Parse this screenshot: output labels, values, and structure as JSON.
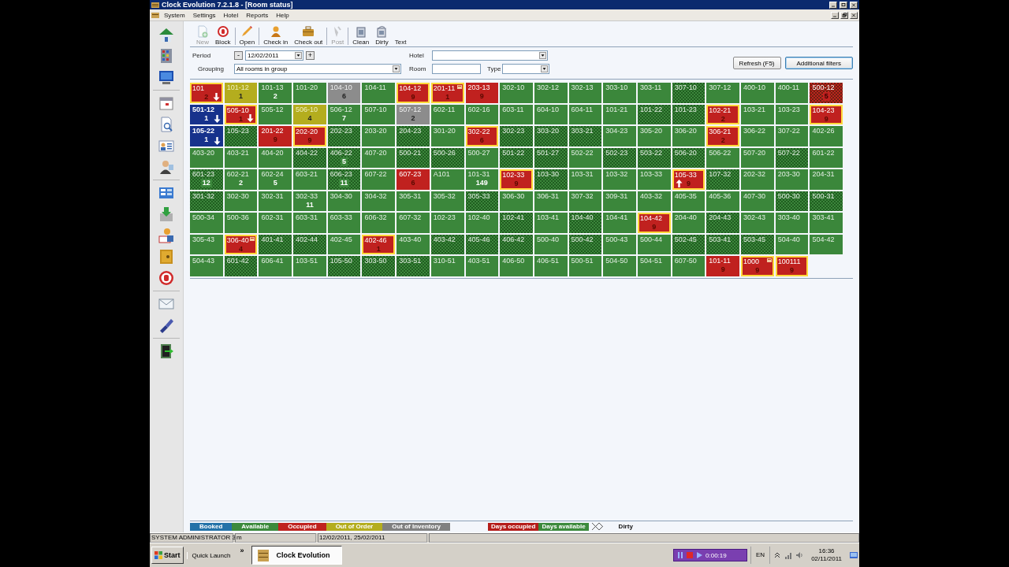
{
  "window": {
    "title": "Clock Evolution 7.2.1.8 - [Room status]"
  },
  "menu": [
    "System",
    "Settings",
    "Hotel",
    "Reports",
    "Help"
  ],
  "toolbar": [
    {
      "kind": "new",
      "label": "New",
      "disabled": true,
      "separator": false
    },
    {
      "kind": "block",
      "label": "Block",
      "disabled": false,
      "separator": true
    },
    {
      "kind": "open",
      "label": "Open",
      "disabled": false,
      "separator": true
    },
    {
      "kind": "checkin",
      "label": "Check in",
      "disabled": false,
      "separator": false
    },
    {
      "kind": "checkout",
      "label": "Check out",
      "disabled": false,
      "separator": true
    },
    {
      "kind": "post",
      "label": "Post",
      "disabled": true,
      "separator": true
    },
    {
      "kind": "clean",
      "label": "Clean",
      "disabled": false,
      "separator": false
    },
    {
      "kind": "dirty",
      "label": "Dirty",
      "disabled": false,
      "separator": false
    },
    {
      "kind": "text",
      "label": "Text",
      "disabled": false,
      "separator": false
    }
  ],
  "filters": {
    "period": {
      "label": "Period",
      "decrement": "-",
      "date": "12/02/2011",
      "increment": "+"
    },
    "grouping": {
      "label": "Grouping",
      "value": "All rooms in group"
    },
    "hotel": {
      "label": "Hotel"
    },
    "room": {
      "label": "Room"
    },
    "type": {
      "label": "Type"
    }
  },
  "buttons": [
    {
      "label": "Refresh (F5)",
      "focused": false
    },
    {
      "label": "Additional filters",
      "focused": true
    }
  ],
  "rooms": [
    {
      "label": "101",
      "count": "2",
      "kind": "occupied",
      "dirty": false,
      "highlighted": true,
      "arrow_down": true,
      "arrow_up": false,
      "note": false
    },
    {
      "label": "101-12",
      "count": "1",
      "kind": "out_of_order",
      "dirty": false,
      "highlighted": false,
      "arrow_down": false,
      "arrow_up": false,
      "note": false
    },
    {
      "label": "101-13",
      "count": "2",
      "kind": "available",
      "dirty": false,
      "highlighted": false,
      "arrow_down": false,
      "arrow_up": false,
      "note": false
    },
    {
      "label": "101-20",
      "kind": "available",
      "dirty": false,
      "highlighted": false,
      "arrow_down": false,
      "arrow_up": false,
      "note": false
    },
    {
      "label": "104-10",
      "count": "6",
      "kind": "out_of_inventory",
      "dirty": false,
      "highlighted": false,
      "arrow_down": false,
      "arrow_up": false,
      "note": false
    },
    {
      "label": "104-11",
      "kind": "available",
      "dirty": false,
      "highlighted": false,
      "arrow_down": false,
      "arrow_up": false,
      "note": false
    },
    {
      "label": "104-12",
      "count": "9",
      "kind": "occupied",
      "dirty": false,
      "highlighted": true,
      "arrow_down": false,
      "arrow_up": false,
      "note": false
    },
    {
      "label": "201-11",
      "count": "1",
      "kind": "occupied",
      "dirty": false,
      "highlighted": true,
      "arrow_down": false,
      "arrow_up": false,
      "note": true
    },
    {
      "label": "203-13",
      "count": "9",
      "kind": "occupied",
      "dirty": false,
      "highlighted": false,
      "arrow_down": false,
      "arrow_up": false,
      "note": false
    },
    {
      "label": "302-10",
      "kind": "available",
      "dirty": false,
      "highlighted": false,
      "arrow_down": false,
      "arrow_up": false,
      "note": false
    },
    {
      "label": "302-12",
      "kind": "available",
      "dirty": false,
      "highlighted": false,
      "arrow_down": false,
      "arrow_up": false,
      "note": false
    },
    {
      "label": "302-13",
      "kind": "available",
      "dirty": false,
      "highlighted": false,
      "arrow_down": false,
      "arrow_up": false,
      "note": false
    },
    {
      "label": "303-10",
      "kind": "available",
      "dirty": false,
      "highlighted": false,
      "arrow_down": false,
      "arrow_up": false,
      "note": false
    },
    {
      "label": "303-11",
      "kind": "available",
      "dirty": false,
      "highlighted": false,
      "arrow_down": false,
      "arrow_up": false,
      "note": false
    },
    {
      "label": "307-10",
      "kind": "available",
      "dirty": true,
      "highlighted": false,
      "arrow_down": false,
      "arrow_up": false,
      "note": false
    },
    {
      "label": "307-12",
      "kind": "available",
      "dirty": false,
      "highlighted": false,
      "arrow_down": false,
      "arrow_up": false,
      "note": false
    },
    {
      "label": "400-10",
      "kind": "available",
      "dirty": false,
      "highlighted": false,
      "arrow_down": false,
      "arrow_up": false,
      "note": false
    },
    {
      "label": "400-11",
      "kind": "available",
      "dirty": false,
      "highlighted": false,
      "arrow_down": false,
      "arrow_up": false,
      "note": false
    },
    {
      "label": "500-12",
      "count": "5",
      "kind": "occupied",
      "dirty": true,
      "highlighted": false,
      "arrow_down": false,
      "arrow_up": false,
      "note": false
    },
    {
      "label": "501-12",
      "count": "1",
      "kind": "booked",
      "dirty": false,
      "highlighted": false,
      "arrow_down": true,
      "arrow_up": false,
      "note": false
    },
    {
      "label": "505-10",
      "count": "1",
      "kind": "occupied",
      "dirty": false,
      "highlighted": true,
      "arrow_down": true,
      "arrow_up": false,
      "note": false
    },
    {
      "label": "505-12",
      "kind": "available",
      "dirty": false,
      "highlighted": false,
      "arrow_down": false,
      "arrow_up": false,
      "note": false
    },
    {
      "label": "506-10",
      "count": "4",
      "kind": "out_of_order",
      "dirty": false,
      "highlighted": false,
      "arrow_down": false,
      "arrow_up": false,
      "note": false
    },
    {
      "label": "506-12",
      "count": "7",
      "kind": "available",
      "dirty": false,
      "highlighted": false,
      "arrow_down": false,
      "arrow_up": false,
      "note": false
    },
    {
      "label": "507-10",
      "kind": "available",
      "dirty": false,
      "highlighted": false,
      "arrow_down": false,
      "arrow_up": false,
      "note": false
    },
    {
      "label": "507-12",
      "count": "2",
      "kind": "out_of_inventory",
      "dirty": false,
      "highlighted": false,
      "arrow_down": false,
      "arrow_up": false,
      "note": false
    },
    {
      "label": "602-11",
      "kind": "available",
      "dirty": false,
      "highlighted": false,
      "arrow_down": false,
      "arrow_up": false,
      "note": false
    },
    {
      "label": "602-16",
      "kind": "available",
      "dirty": false,
      "highlighted": false,
      "arrow_down": false,
      "arrow_up": false,
      "note": false
    },
    {
      "label": "603-11",
      "kind": "available",
      "dirty": false,
      "highlighted": false,
      "arrow_down": false,
      "arrow_up": false,
      "note": false
    },
    {
      "label": "604-10",
      "kind": "available",
      "dirty": false,
      "highlighted": false,
      "arrow_down": false,
      "arrow_up": false,
      "note": false
    },
    {
      "label": "604-11",
      "kind": "available",
      "dirty": false,
      "highlighted": false,
      "arrow_down": false,
      "arrow_up": false,
      "note": false
    },
    {
      "label": "101-21",
      "kind": "available",
      "dirty": false,
      "highlighted": false,
      "arrow_down": false,
      "arrow_up": false,
      "note": false
    },
    {
      "label": "101-22",
      "kind": "available",
      "dirty": true,
      "highlighted": false,
      "arrow_down": false,
      "arrow_up": false,
      "note": false
    },
    {
      "label": "101-23",
      "kind": "available",
      "dirty": true,
      "highlighted": false,
      "arrow_down": false,
      "arrow_up": false,
      "note": false
    },
    {
      "label": "102-21",
      "count": "2",
      "kind": "occupied",
      "dirty": false,
      "highlighted": true,
      "arrow_down": false,
      "arrow_up": false,
      "note": false
    },
    {
      "label": "103-21",
      "kind": "available",
      "dirty": false,
      "highlighted": false,
      "arrow_down": false,
      "arrow_up": false,
      "note": false
    },
    {
      "label": "103-23",
      "kind": "available",
      "dirty": false,
      "highlighted": false,
      "arrow_down": false,
      "arrow_up": false,
      "note": false
    },
    {
      "label": "104-23",
      "count": "9",
      "kind": "occupied",
      "dirty": false,
      "highlighted": true,
      "arrow_down": false,
      "arrow_up": false,
      "note": false
    },
    {
      "label": "105-22",
      "count": "1",
      "kind": "booked",
      "dirty": false,
      "highlighted": false,
      "arrow_down": true,
      "arrow_up": false,
      "note": false
    },
    {
      "label": "105-23",
      "kind": "available",
      "dirty": true,
      "highlighted": false,
      "arrow_down": false,
      "arrow_up": false,
      "note": false
    },
    {
      "label": "201-22",
      "count": "9",
      "kind": "occupied",
      "dirty": false,
      "highlighted": false,
      "arrow_down": false,
      "arrow_up": false,
      "note": false
    },
    {
      "label": "202-20",
      "count": "9",
      "kind": "occupied",
      "dirty": false,
      "highlighted": true,
      "arrow_down": false,
      "arrow_up": false,
      "note": false
    },
    {
      "label": "202-23",
      "kind": "available",
      "dirty": true,
      "highlighted": false,
      "arrow_down": false,
      "arrow_up": false,
      "note": false
    },
    {
      "label": "203-20",
      "kind": "available",
      "dirty": false,
      "highlighted": false,
      "arrow_down": false,
      "arrow_up": false,
      "note": false
    },
    {
      "label": "204-23",
      "kind": "available",
      "dirty": true,
      "highlighted": false,
      "arrow_down": false,
      "arrow_up": false,
      "note": false
    },
    {
      "label": "301-20",
      "kind": "available",
      "dirty": false,
      "highlighted": false,
      "arrow_down": false,
      "arrow_up": false,
      "note": false
    },
    {
      "label": "302-22",
      "count": "6",
      "kind": "occupied",
      "dirty": false,
      "highlighted": true,
      "arrow_down": false,
      "arrow_up": false,
      "note": false
    },
    {
      "label": "302-23",
      "kind": "available",
      "dirty": true,
      "highlighted": false,
      "arrow_down": false,
      "arrow_up": false,
      "note": false
    },
    {
      "label": "303-20",
      "kind": "available",
      "dirty": true,
      "highlighted": false,
      "arrow_down": false,
      "arrow_up": false,
      "note": false
    },
    {
      "label": "303-21",
      "kind": "available",
      "dirty": true,
      "highlighted": false,
      "arrow_down": false,
      "arrow_up": false,
      "note": false
    },
    {
      "label": "304-23",
      "kind": "available",
      "dirty": false,
      "highlighted": false,
      "arrow_down": false,
      "arrow_up": false,
      "note": false
    },
    {
      "label": "305-20",
      "kind": "available",
      "dirty": false,
      "highlighted": false,
      "arrow_down": false,
      "arrow_up": false,
      "note": false
    },
    {
      "label": "306-20",
      "kind": "available",
      "dirty": false,
      "highlighted": false,
      "arrow_down": false,
      "arrow_up": false,
      "note": false
    },
    {
      "label": "306-21",
      "count": "2",
      "kind": "occupied",
      "dirty": false,
      "highlighted": true,
      "arrow_down": false,
      "arrow_up": false,
      "note": false
    },
    {
      "label": "306-22",
      "kind": "available",
      "dirty": false,
      "highlighted": false,
      "arrow_down": false,
      "arrow_up": false,
      "note": false
    },
    {
      "label": "307-22",
      "kind": "available",
      "dirty": false,
      "highlighted": false,
      "arrow_down": false,
      "arrow_up": false,
      "note": false
    },
    {
      "label": "402-26",
      "kind": "available",
      "dirty": false,
      "highlighted": false,
      "arrow_down": false,
      "arrow_up": false,
      "note": false
    },
    {
      "label": "403-20",
      "kind": "available",
      "dirty": false,
      "highlighted": false,
      "arrow_down": false,
      "arrow_up": false,
      "note": false
    },
    {
      "label": "403-21",
      "kind": "available",
      "dirty": false,
      "highlighted": false,
      "arrow_down": false,
      "arrow_up": false,
      "note": false
    },
    {
      "label": "404-20",
      "kind": "available",
      "dirty": false,
      "highlighted": false,
      "arrow_down": false,
      "arrow_up": false,
      "note": false
    },
    {
      "label": "404-22",
      "kind": "available",
      "dirty": true,
      "highlighted": false,
      "arrow_down": false,
      "arrow_up": false,
      "note": false
    },
    {
      "label": "406-22",
      "count": "5",
      "kind": "available",
      "dirty": true,
      "highlighted": false,
      "arrow_down": false,
      "arrow_up": false,
      "note": false
    },
    {
      "label": "407-20",
      "kind": "available",
      "dirty": false,
      "highlighted": false,
      "arrow_down": false,
      "arrow_up": false,
      "note": false
    },
    {
      "label": "500-21",
      "kind": "available",
      "dirty": true,
      "highlighted": false,
      "arrow_down": false,
      "arrow_up": false,
      "note": false
    },
    {
      "label": "500-26",
      "kind": "available",
      "dirty": true,
      "highlighted": false,
      "arrow_down": false,
      "arrow_up": false,
      "note": false
    },
    {
      "label": "500-27",
      "kind": "available",
      "dirty": false,
      "highlighted": false,
      "arrow_down": false,
      "arrow_up": false,
      "note": false
    },
    {
      "label": "501-22",
      "kind": "available",
      "dirty": true,
      "highlighted": false,
      "arrow_down": false,
      "arrow_up": false,
      "note": false
    },
    {
      "label": "501-27",
      "kind": "available",
      "dirty": true,
      "highlighted": false,
      "arrow_down": false,
      "arrow_up": false,
      "note": false
    },
    {
      "label": "502-22",
      "kind": "available",
      "dirty": false,
      "highlighted": false,
      "arrow_down": false,
      "arrow_up": false,
      "note": false
    },
    {
      "label": "502-23",
      "kind": "available",
      "dirty": true,
      "highlighted": false,
      "arrow_down": false,
      "arrow_up": false,
      "note": false
    },
    {
      "label": "503-22",
      "kind": "available",
      "dirty": true,
      "highlighted": false,
      "arrow_down": false,
      "arrow_up": false,
      "note": false
    },
    {
      "label": "506-20",
      "kind": "available",
      "dirty": true,
      "highlighted": false,
      "arrow_down": false,
      "arrow_up": false,
      "note": false
    },
    {
      "label": "506-22",
      "kind": "available",
      "dirty": false,
      "highlighted": false,
      "arrow_down": false,
      "arrow_up": false,
      "note": false
    },
    {
      "label": "507-20",
      "kind": "available",
      "dirty": false,
      "highlighted": false,
      "arrow_down": false,
      "arrow_up": false,
      "note": false
    },
    {
      "label": "507-22",
      "kind": "available",
      "dirty": true,
      "highlighted": false,
      "arrow_down": false,
      "arrow_up": false,
      "note": false
    },
    {
      "label": "601-22",
      "kind": "available",
      "dirty": false,
      "highlighted": false,
      "arrow_down": false,
      "arrow_up": false,
      "note": false
    },
    {
      "label": "601-23",
      "count": "12",
      "kind": "available",
      "dirty": true,
      "highlighted": false,
      "arrow_down": false,
      "arrow_up": false,
      "note": false
    },
    {
      "label": "602-21",
      "count": "2",
      "kind": "available",
      "dirty": false,
      "highlighted": false,
      "arrow_down": false,
      "arrow_up": false,
      "note": false
    },
    {
      "label": "602-24",
      "count": "5",
      "kind": "available",
      "dirty": false,
      "highlighted": false,
      "arrow_down": false,
      "arrow_up": false,
      "note": false
    },
    {
      "label": "603-21",
      "kind": "available",
      "dirty": false,
      "highlighted": false,
      "arrow_down": false,
      "arrow_up": false,
      "note": false
    },
    {
      "label": "606-23",
      "count": "11",
      "kind": "available",
      "dirty": true,
      "highlighted": false,
      "arrow_down": false,
      "arrow_up": false,
      "note": false
    },
    {
      "label": "607-22",
      "kind": "available",
      "dirty": false,
      "highlighted": false,
      "arrow_down": false,
      "arrow_up": false,
      "note": false
    },
    {
      "label": "607-23",
      "count": "6",
      "kind": "occupied",
      "dirty": false,
      "highlighted": false,
      "arrow_down": false,
      "arrow_up": false,
      "note": false
    },
    {
      "label": "A101",
      "kind": "available",
      "dirty": false,
      "highlighted": false,
      "arrow_down": false,
      "arrow_up": false,
      "note": false
    },
    {
      "label": "101-31",
      "count": "149",
      "kind": "available",
      "dirty": false,
      "highlighted": false,
      "arrow_down": false,
      "arrow_up": false,
      "note": false
    },
    {
      "label": "102-33",
      "count": "9",
      "kind": "occupied",
      "dirty": false,
      "highlighted": true,
      "arrow_down": false,
      "arrow_up": false,
      "note": false
    },
    {
      "label": "103-30",
      "kind": "available",
      "dirty": true,
      "highlighted": false,
      "arrow_down": false,
      "arrow_up": false,
      "note": false
    },
    {
      "label": "103-31",
      "kind": "available",
      "dirty": false,
      "highlighted": false,
      "arrow_down": false,
      "arrow_up": false,
      "note": false
    },
    {
      "label": "103-32",
      "kind": "available",
      "dirty": false,
      "highlighted": false,
      "arrow_down": false,
      "arrow_up": false,
      "note": false
    },
    {
      "label": "103-33",
      "kind": "available",
      "dirty": false,
      "highlighted": false,
      "arrow_down": false,
      "arrow_up": false,
      "note": false
    },
    {
      "label": "105-33",
      "count": "9",
      "kind": "occupied",
      "dirty": false,
      "highlighted": true,
      "arrow_down": false,
      "arrow_up": true,
      "note": false
    },
    {
      "label": "107-32",
      "kind": "available",
      "dirty": true,
      "highlighted": false,
      "arrow_down": false,
      "arrow_up": false,
      "note": false
    },
    {
      "label": "202-32",
      "kind": "available",
      "dirty": false,
      "highlighted": false,
      "arrow_down": false,
      "arrow_up": false,
      "note": false
    },
    {
      "label": "203-30",
      "kind": "available",
      "dirty": false,
      "highlighted": false,
      "arrow_down": false,
      "arrow_up": false,
      "note": false
    },
    {
      "label": "204-31",
      "kind": "available",
      "dirty": false,
      "highlighted": false,
      "arrow_down": false,
      "arrow_up": false,
      "note": false
    },
    {
      "label": "301-32",
      "kind": "available",
      "dirty": true,
      "highlighted": false,
      "arrow_down": false,
      "arrow_up": false,
      "note": false
    },
    {
      "label": "302-30",
      "kind": "available",
      "dirty": false,
      "highlighted": false,
      "arrow_down": false,
      "arrow_up": false,
      "note": false
    },
    {
      "label": "302-31",
      "kind": "available",
      "dirty": false,
      "highlighted": false,
      "arrow_down": false,
      "arrow_up": false,
      "note": false
    },
    {
      "label": "302-33",
      "count": "11",
      "kind": "available",
      "dirty": false,
      "highlighted": false,
      "arrow_down": false,
      "arrow_up": false,
      "note": false
    },
    {
      "label": "304-30",
      "kind": "available",
      "dirty": false,
      "highlighted": false,
      "arrow_down": false,
      "arrow_up": false,
      "note": false
    },
    {
      "label": "304-32",
      "kind": "available",
      "dirty": false,
      "highlighted": false,
      "arrow_down": false,
      "arrow_up": false,
      "note": false
    },
    {
      "label": "305-31",
      "kind": "available",
      "dirty": false,
      "highlighted": false,
      "arrow_down": false,
      "arrow_up": false,
      "note": false
    },
    {
      "label": "305-32",
      "kind": "available",
      "dirty": false,
      "highlighted": false,
      "arrow_down": false,
      "arrow_up": false,
      "note": false
    },
    {
      "label": "305-33",
      "kind": "available",
      "dirty": true,
      "highlighted": false,
      "arrow_down": false,
      "arrow_up": false,
      "note": false
    },
    {
      "label": "306-30",
      "kind": "available",
      "dirty": false,
      "highlighted": false,
      "arrow_down": false,
      "arrow_up": false,
      "note": false
    },
    {
      "label": "306-31",
      "kind": "available",
      "dirty": false,
      "highlighted": false,
      "arrow_down": false,
      "arrow_up": false,
      "note": false
    },
    {
      "label": "307-32",
      "kind": "available",
      "dirty": false,
      "highlighted": false,
      "arrow_down": false,
      "arrow_up": false,
      "note": false
    },
    {
      "label": "309-31",
      "kind": "available",
      "dirty": false,
      "highlighted": false,
      "arrow_down": false,
      "arrow_up": false,
      "note": false
    },
    {
      "label": "403-32",
      "kind": "available",
      "dirty": false,
      "highlighted": false,
      "arrow_down": false,
      "arrow_up": false,
      "note": false
    },
    {
      "label": "405-35",
      "kind": "available",
      "dirty": false,
      "highlighted": false,
      "arrow_down": false,
      "arrow_up": false,
      "note": false
    },
    {
      "label": "405-36",
      "kind": "available",
      "dirty": false,
      "highlighted": false,
      "arrow_down": false,
      "arrow_up": false,
      "note": false
    },
    {
      "label": "407-30",
      "kind": "available",
      "dirty": false,
      "highlighted": false,
      "arrow_down": false,
      "arrow_up": false,
      "note": false
    },
    {
      "label": "500-30",
      "kind": "available",
      "dirty": true,
      "highlighted": false,
      "arrow_down": false,
      "arrow_up": false,
      "note": false
    },
    {
      "label": "500-31",
      "kind": "available",
      "dirty": true,
      "highlighted": false,
      "arrow_down": false,
      "arrow_up": false,
      "note": false
    },
    {
      "label": "500-34",
      "kind": "available",
      "dirty": false,
      "highlighted": false,
      "arrow_down": false,
      "arrow_up": false,
      "note": false
    },
    {
      "label": "500-36",
      "kind": "available",
      "dirty": false,
      "highlighted": false,
      "arrow_down": false,
      "arrow_up": false,
      "note": false
    },
    {
      "label": "602-31",
      "kind": "available",
      "dirty": false,
      "highlighted": false,
      "arrow_down": false,
      "arrow_up": false,
      "note": false
    },
    {
      "label": "603-31",
      "kind": "available",
      "dirty": false,
      "highlighted": false,
      "arrow_down": false,
      "arrow_up": false,
      "note": false
    },
    {
      "label": "603-33",
      "kind": "available",
      "dirty": false,
      "highlighted": false,
      "arrow_down": false,
      "arrow_up": false,
      "note": false
    },
    {
      "label": "606-32",
      "kind": "available",
      "dirty": false,
      "highlighted": false,
      "arrow_down": false,
      "arrow_up": false,
      "note": false
    },
    {
      "label": "607-32",
      "kind": "available",
      "dirty": false,
      "highlighted": false,
      "arrow_down": false,
      "arrow_up": false,
      "note": false
    },
    {
      "label": "102-23",
      "kind": "available",
      "dirty": false,
      "highlighted": false,
      "arrow_down": false,
      "arrow_up": false,
      "note": false
    },
    {
      "label": "102-40",
      "kind": "available",
      "dirty": false,
      "highlighted": false,
      "arrow_down": false,
      "arrow_up": false,
      "note": false
    },
    {
      "label": "102-41",
      "kind": "available",
      "dirty": true,
      "highlighted": false,
      "arrow_down": false,
      "arrow_up": false,
      "note": false
    },
    {
      "label": "103-41",
      "kind": "available",
      "dirty": false,
      "highlighted": false,
      "arrow_down": false,
      "arrow_up": false,
      "note": false
    },
    {
      "label": "104-40",
      "kind": "available",
      "dirty": true,
      "highlighted": false,
      "arrow_down": false,
      "arrow_up": false,
      "note": false
    },
    {
      "label": "104-41",
      "kind": "available",
      "dirty": false,
      "highlighted": false,
      "arrow_down": false,
      "arrow_up": false,
      "note": false
    },
    {
      "label": "104-42",
      "count": "9",
      "kind": "occupied",
      "dirty": false,
      "highlighted": true,
      "arrow_down": false,
      "arrow_up": false,
      "note": false
    },
    {
      "label": "204-40",
      "kind": "available",
      "dirty": false,
      "highlighted": false,
      "arrow_down": false,
      "arrow_up": false,
      "note": false
    },
    {
      "label": "204-43",
      "kind": "available",
      "dirty": true,
      "highlighted": false,
      "arrow_down": false,
      "arrow_up": false,
      "note": false
    },
    {
      "label": "302-43",
      "kind": "available",
      "dirty": false,
      "highlighted": false,
      "arrow_down": false,
      "arrow_up": false,
      "note": false
    },
    {
      "label": "303-40",
      "kind": "available",
      "dirty": false,
      "highlighted": false,
      "arrow_down": false,
      "arrow_up": false,
      "note": false
    },
    {
      "label": "303-41",
      "kind": "available",
      "dirty": false,
      "highlighted": false,
      "arrow_down": false,
      "arrow_up": false,
      "note": false
    },
    {
      "label": "305-43",
      "kind": "available",
      "dirty": false,
      "highlighted": false,
      "arrow_down": false,
      "arrow_up": false,
      "note": false
    },
    {
      "label": "306-40",
      "count": "4",
      "kind": "occupied",
      "dirty": false,
      "highlighted": true,
      "arrow_down": false,
      "arrow_up": false,
      "note": true
    },
    {
      "label": "401-41",
      "kind": "available",
      "dirty": true,
      "highlighted": false,
      "arrow_down": false,
      "arrow_up": false,
      "note": false
    },
    {
      "label": "402-44",
      "kind": "available",
      "dirty": true,
      "highlighted": false,
      "arrow_down": false,
      "arrow_up": false,
      "note": false
    },
    {
      "label": "402-45",
      "kind": "available",
      "dirty": false,
      "highlighted": false,
      "arrow_down": false,
      "arrow_up": false,
      "note": false
    },
    {
      "label": "402-46",
      "count": "1",
      "kind": "occupied",
      "dirty": false,
      "highlighted": true,
      "arrow_down": false,
      "arrow_up": false,
      "note": false
    },
    {
      "label": "403-40",
      "kind": "available",
      "dirty": false,
      "highlighted": false,
      "arrow_down": false,
      "arrow_up": false,
      "note": false
    },
    {
      "label": "403-42",
      "kind": "available",
      "dirty": true,
      "highlighted": false,
      "arrow_down": false,
      "arrow_up": false,
      "note": false
    },
    {
      "label": "405-46",
      "kind": "available",
      "dirty": true,
      "highlighted": false,
      "arrow_down": false,
      "arrow_up": false,
      "note": false
    },
    {
      "label": "406-42",
      "kind": "available",
      "dirty": true,
      "highlighted": false,
      "arrow_down": false,
      "arrow_up": false,
      "note": false
    },
    {
      "label": "500-40",
      "kind": "available",
      "dirty": false,
      "highlighted": false,
      "arrow_down": false,
      "arrow_up": false,
      "note": false
    },
    {
      "label": "500-42",
      "kind": "available",
      "dirty": true,
      "highlighted": false,
      "arrow_down": false,
      "arrow_up": false,
      "note": false
    },
    {
      "label": "500-43",
      "kind": "available",
      "dirty": false,
      "highlighted": false,
      "arrow_down": false,
      "arrow_up": false,
      "note": false
    },
    {
      "label": "500-44",
      "kind": "available",
      "dirty": false,
      "highlighted": false,
      "arrow_down": false,
      "arrow_up": false,
      "note": false
    },
    {
      "label": "502-45",
      "kind": "available",
      "dirty": true,
      "highlighted": false,
      "arrow_down": false,
      "arrow_up": false,
      "note": false
    },
    {
      "label": "503-41",
      "kind": "available",
      "dirty": true,
      "highlighted": false,
      "arrow_down": false,
      "arrow_up": false,
      "note": false
    },
    {
      "label": "503-45",
      "kind": "available",
      "dirty": true,
      "highlighted": false,
      "arrow_down": false,
      "arrow_up": false,
      "note": false
    },
    {
      "label": "504-40",
      "kind": "available",
      "dirty": false,
      "highlighted": false,
      "arrow_down": false,
      "arrow_up": false,
      "note": false
    },
    {
      "label": "504-42",
      "kind": "available",
      "dirty": false,
      "highlighted": false,
      "arrow_down": false,
      "arrow_up": false,
      "note": false
    },
    {
      "label": "504-43",
      "kind": "available",
      "dirty": false,
      "highlighted": false,
      "arrow_down": false,
      "arrow_up": false,
      "note": false
    },
    {
      "label": "601-42",
      "kind": "available",
      "dirty": true,
      "highlighted": false,
      "arrow_down": false,
      "arrow_up": false,
      "note": false
    },
    {
      "label": "606-41",
      "kind": "available",
      "dirty": false,
      "highlighted": false,
      "arrow_down": false,
      "arrow_up": false,
      "note": false
    },
    {
      "label": "103-51",
      "kind": "available",
      "dirty": false,
      "highlighted": false,
      "arrow_down": false,
      "arrow_up": false,
      "note": false
    },
    {
      "label": "105-50",
      "kind": "available",
      "dirty": true,
      "highlighted": false,
      "arrow_down": false,
      "arrow_up": false,
      "note": false
    },
    {
      "label": "303-50",
      "kind": "available",
      "dirty": true,
      "highlighted": false,
      "arrow_down": false,
      "arrow_up": false,
      "note": false
    },
    {
      "label": "303-51",
      "kind": "available",
      "dirty": true,
      "highlighted": false,
      "arrow_down": false,
      "arrow_up": false,
      "note": false
    },
    {
      "label": "310-51",
      "kind": "available",
      "dirty": false,
      "highlighted": false,
      "arrow_down": false,
      "arrow_up": false,
      "note": false
    },
    {
      "label": "403-51",
      "kind": "available",
      "dirty": false,
      "highlighted": false,
      "arrow_down": false,
      "arrow_up": false,
      "note": false
    },
    {
      "label": "406-50",
      "kind": "available",
      "dirty": false,
      "highlighted": false,
      "arrow_down": false,
      "arrow_up": false,
      "note": false
    },
    {
      "label": "406-51",
      "kind": "available",
      "dirty": false,
      "highlighted": false,
      "arrow_down": false,
      "arrow_up": false,
      "note": false
    },
    {
      "label": "500-51",
      "kind": "available",
      "dirty": false,
      "highlighted": false,
      "arrow_down": false,
      "arrow_up": false,
      "note": false
    },
    {
      "label": "504-50",
      "kind": "available",
      "dirty": false,
      "highlighted": false,
      "arrow_down": false,
      "arrow_up": false,
      "note": false
    },
    {
      "label": "504-51",
      "kind": "available",
      "dirty": false,
      "highlighted": false,
      "arrow_down": false,
      "arrow_up": false,
      "note": false
    },
    {
      "label": "607-50",
      "kind": "available",
      "dirty": false,
      "highlighted": false,
      "arrow_down": false,
      "arrow_up": false,
      "note": false
    },
    {
      "label": "101-11",
      "count": "9",
      "kind": "occupied",
      "dirty": false,
      "highlighted": false,
      "arrow_down": false,
      "arrow_up": false,
      "note": false
    },
    {
      "label": "1000",
      "count": "9",
      "kind": "occupied",
      "dirty": false,
      "highlighted": true,
      "arrow_down": false,
      "arrow_up": false,
      "note": true
    },
    {
      "label": "100111",
      "count": "9",
      "kind": "occupied",
      "dirty": false,
      "highlighted": true,
      "arrow_down": false,
      "arrow_up": false,
      "note": false
    }
  ],
  "legend": [
    {
      "kind": "status",
      "label": "Booked",
      "color": "#2372a8"
    },
    {
      "kind": "status",
      "label": "Available",
      "color": "#3c8a3c"
    },
    {
      "kind": "status",
      "label": "Occupied",
      "color": "#c0231f"
    },
    {
      "kind": "status",
      "label": "Out of Order",
      "color": "#b4ad1e"
    },
    {
      "kind": "status",
      "label": "Out of Inventory",
      "color": "#808080"
    },
    {
      "kind": "days",
      "label": "Days occupied",
      "color": "#b51d1a"
    },
    {
      "kind": "days",
      "label": "Days available",
      "color": "#3c8a3c"
    },
    {
      "kind": "pattern",
      "label": "Dirty"
    }
  ],
  "status_bar": [
    "SYSTEM ADMINISTRATOR 3",
    "m",
    "12/02/2011, 25/02/2011"
  ],
  "taskbar": {
    "start": "Start",
    "quick_launch": "Quick Launch",
    "chevron": "»",
    "task": "Clock Evolution",
    "recorder_time": "0:00:19",
    "language": "EN",
    "time": "16:36",
    "date": "02/11/2011"
  }
}
